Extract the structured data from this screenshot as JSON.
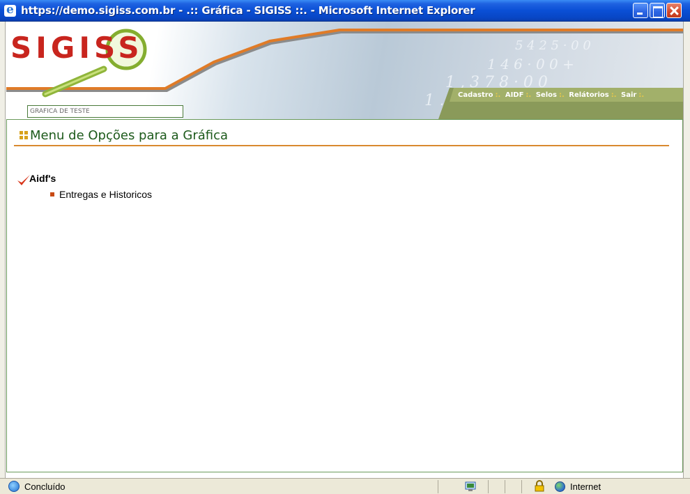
{
  "window": {
    "title": "https://demo.sigiss.com.br - .:: Gráfica - SIGISS ::. - Microsoft Internet Explorer"
  },
  "header": {
    "logo_text": "SIGISS",
    "entity_name": "GRAFICA DE TESTE",
    "nav": [
      {
        "label": "Cadastro"
      },
      {
        "label": "AIDF"
      },
      {
        "label": "Selos"
      },
      {
        "label": "Relátorios"
      },
      {
        "label": "Sair"
      }
    ],
    "nav_separator": ":."
  },
  "main": {
    "section_title": "Menu de Opções para a Gráfica",
    "group": {
      "title": "Aidf's",
      "items": [
        {
          "label": "Entregas e Historicos"
        }
      ]
    }
  },
  "statusbar": {
    "status": "Concluído",
    "zone": "Internet"
  },
  "colors": {
    "title_bar": "#0a4fd6",
    "accent_green": "#1d5a1b",
    "accent_orange": "#d9892f",
    "nav_green": "#8a9a5a"
  }
}
